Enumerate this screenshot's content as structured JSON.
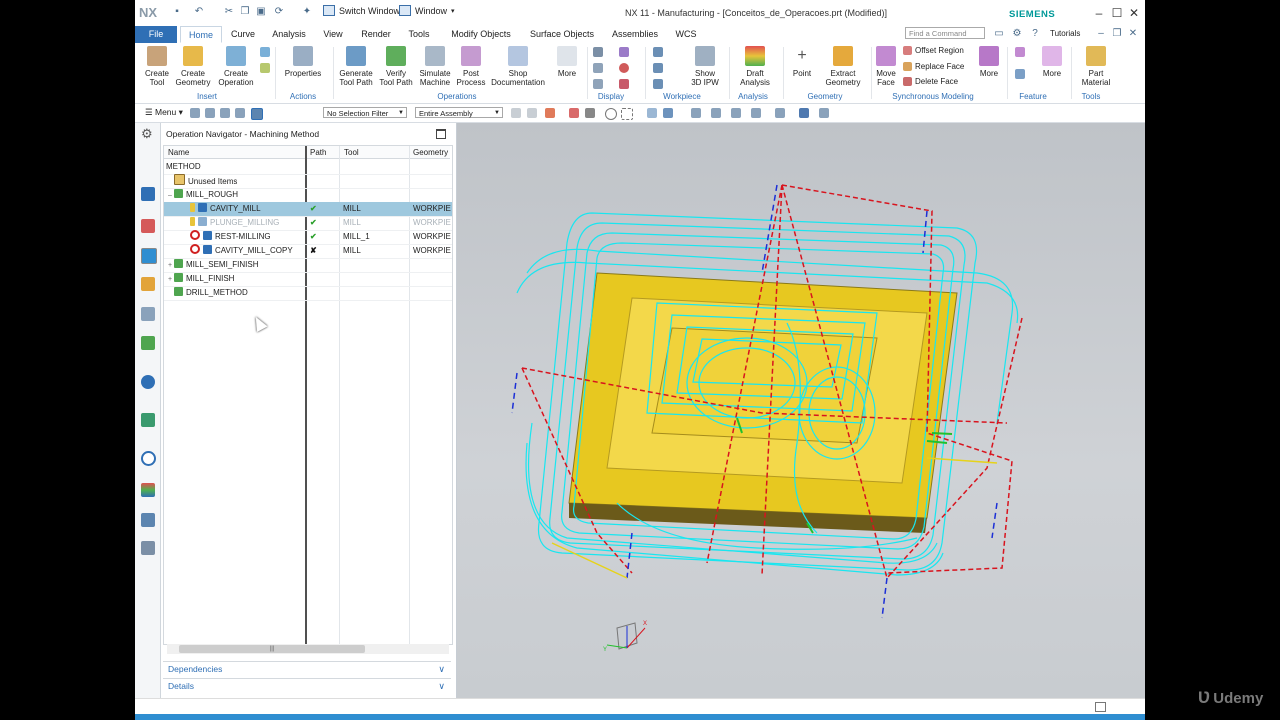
{
  "titlebar": {
    "logo": "NX",
    "switch_window": "Switch Window",
    "window_menu": "Window",
    "title": "NX 11 - Manufacturing - [Conceitos_de_Operacoes.prt (Modified)]",
    "brand": "SIEMENS"
  },
  "tabs": [
    "File",
    "Home",
    "Curve",
    "Analysis",
    "View",
    "Render",
    "Tools",
    "Modify Objects",
    "Surface Objects",
    "Assemblies",
    "WCS"
  ],
  "active_tab": "Home",
  "command_finder": {
    "placeholder": "Find a Command"
  },
  "tutorials": "Tutorials",
  "ribbon": {
    "buttons": [
      {
        "id": "create-tool",
        "l1": "Create",
        "l2": "Tool"
      },
      {
        "id": "create-geometry",
        "l1": "Create",
        "l2": "Geometry"
      },
      {
        "id": "create-operation",
        "l1": "Create",
        "l2": "Operation"
      },
      {
        "id": "properties",
        "l1": "Properties",
        "l2": ""
      },
      {
        "id": "generate-tool-path",
        "l1": "Generate",
        "l2": "Tool Path"
      },
      {
        "id": "verify-tool-path",
        "l1": "Verify",
        "l2": "Tool Path"
      },
      {
        "id": "simulate-machine",
        "l1": "Simulate",
        "l2": "Machine"
      },
      {
        "id": "post-process",
        "l1": "Post",
        "l2": "Process"
      },
      {
        "id": "shop-documentation",
        "l1": "Shop",
        "l2": "Documentation"
      },
      {
        "id": "more-ops",
        "l1": "More",
        "l2": ""
      },
      {
        "id": "show-3d-ipw",
        "l1": "Show",
        "l2": "3D IPW"
      },
      {
        "id": "draft-analysis",
        "l1": "Draft",
        "l2": "Analysis"
      },
      {
        "id": "point",
        "l1": "Point",
        "l2": ""
      },
      {
        "id": "extract-geometry",
        "l1": "Extract",
        "l2": "Geometry"
      },
      {
        "id": "move-face",
        "l1": "Move",
        "l2": "Face"
      },
      {
        "id": "more-sync",
        "l1": "More",
        "l2": ""
      },
      {
        "id": "more-feature",
        "l1": "More",
        "l2": ""
      },
      {
        "id": "part-material",
        "l1": "Part",
        "l2": "Material"
      }
    ],
    "sync_small": [
      "Offset Region",
      "Replace Face",
      "Delete Face"
    ],
    "groups": [
      "Insert",
      "Actions",
      "Operations",
      "Display",
      "Workpiece",
      "Analysis",
      "Geometry",
      "Synchronous Modeling",
      "Feature",
      "Tools"
    ]
  },
  "toolbar": {
    "menu": "Menu",
    "selection_filter": "No Selection Filter",
    "assembly_scope": "Entire Assembly"
  },
  "navigator": {
    "title": "Operation Navigator - Machining Method",
    "columns": [
      "Name",
      "Path",
      "Tool",
      "Geometry"
    ],
    "rows": [
      {
        "name": "METHOD",
        "path": "",
        "tool": "",
        "geom": ""
      },
      {
        "name": "Unused Items",
        "path": "",
        "tool": "",
        "geom": ""
      },
      {
        "name": "MILL_ROUGH",
        "path": "",
        "tool": "",
        "geom": ""
      },
      {
        "name": "CAVITY_MILL",
        "path": "✔",
        "tool": "MILL",
        "geom": "WORKPIECE"
      },
      {
        "name": "PLUNGE_MILLING",
        "path": "✔",
        "tool": "MILL",
        "geom": "WORKPIECE"
      },
      {
        "name": "REST-MILLING",
        "path": "✔",
        "tool": "MILL_1",
        "geom": "WORKPIECE"
      },
      {
        "name": "CAVITY_MILL_COPY",
        "path": "✘",
        "tool": "MILL",
        "geom": "WORKPIECE"
      },
      {
        "name": "MILL_SEMI_FINISH",
        "path": "",
        "tool": "",
        "geom": ""
      },
      {
        "name": "MILL_FINISH",
        "path": "",
        "tool": "",
        "geom": ""
      },
      {
        "name": "DRILL_METHOD",
        "path": "",
        "tool": "",
        "geom": ""
      }
    ],
    "dependencies": "Dependencies",
    "details": "Details"
  },
  "viewport": {
    "axis_x": "X",
    "axis_y": "Y"
  },
  "watermark": "Udemy",
  "colors": {
    "accent": "#2f6fb5",
    "selection": "#9ec8de",
    "toolpath": "#19e6f0",
    "part": "#f2d21e",
    "check": "#2ca02c"
  }
}
